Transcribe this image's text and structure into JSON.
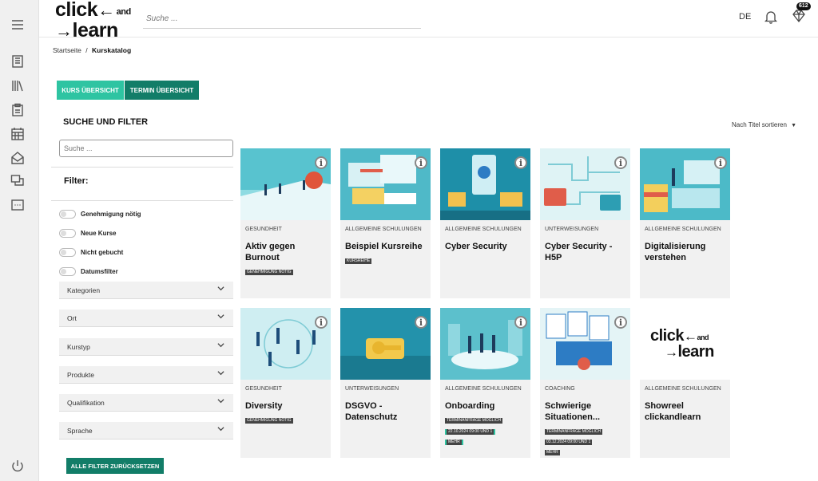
{
  "header": {
    "logo_line1": "click",
    "logo_and": "and",
    "logo_line2": "learn",
    "search_placeholder": "Suche ...",
    "language": "DE",
    "badge_count": "612"
  },
  "breadcrumb": {
    "home": "Startseite",
    "separator": "/",
    "current": "Kurskatalog"
  },
  "tabs": [
    {
      "label": "KURS ÜBERSICHT"
    },
    {
      "label": "TERMIN ÜBERSICHT"
    }
  ],
  "filter": {
    "heading": "SUCHE UND FILTER",
    "search_placeholder": "Suche ...",
    "label": "Filter:",
    "toggles": [
      {
        "label": "Genehmigung nötig"
      },
      {
        "label": "Neue Kurse"
      },
      {
        "label": "Nicht gebucht"
      },
      {
        "label": "Datumsfilter"
      }
    ],
    "accordions": [
      {
        "label": "Kategorien"
      },
      {
        "label": "Ort"
      },
      {
        "label": "Kurstyp"
      },
      {
        "label": "Produkte"
      },
      {
        "label": "Qualifikation"
      },
      {
        "label": "Sprache"
      }
    ],
    "reset_label": "ALLE FILTER ZURÜCKSETZEN"
  },
  "sort_label": "Nach Titel sortieren",
  "courses": [
    {
      "category": "GESUNDHEIT",
      "title": "Aktiv gegen Burnout",
      "tags": [
        "GENEHMIGUNG NÖTIG"
      ]
    },
    {
      "category": "ALLGEMEINE SCHULUNGEN",
      "title": "Beispiel Kursreihe",
      "tags": [
        "KURSREIHE"
      ]
    },
    {
      "category": "ALLGEMEINE SCHULUNGEN",
      "title": "Cyber Security",
      "tags": []
    },
    {
      "category": "UNTERWEISUNGEN",
      "title": "Cyber Security - H5P",
      "tags": []
    },
    {
      "category": "ALLGEMEINE SCHULUNGEN",
      "title": "Digitalisierung verstehen",
      "tags": []
    },
    {
      "category": "GESUNDHEIT",
      "title": "Diversity",
      "tags": [
        "GENEHMIGUNG NÖTIG"
      ]
    },
    {
      "category": "UNTERWEISUNGEN",
      "title": "DSGVO - Datenschutz",
      "tags": []
    },
    {
      "category": "ALLGEMEINE SCHULUNGEN",
      "title": "Onboarding",
      "tags": [
        "TERMINANFRAGE MÖGLICH",
        "22.10.2024 09:00 UND 1",
        "MEHR"
      ]
    },
    {
      "category": "COACHING",
      "title": "Schwierige Situationen...",
      "tags": [
        "TERMINANFRAGE MÖGLICH",
        "03.12.2024 09:00 UND 1",
        "MEHR"
      ]
    },
    {
      "category": "ALLGEMEINE SCHULUNGEN",
      "title": "Showreel clickandlearn",
      "tags": []
    }
  ],
  "colors": {
    "accent": "#2ec4a2",
    "accent_dark": "#127d68",
    "card_bg": "#f1f1f1",
    "image_teal": "#3fb7c6"
  }
}
